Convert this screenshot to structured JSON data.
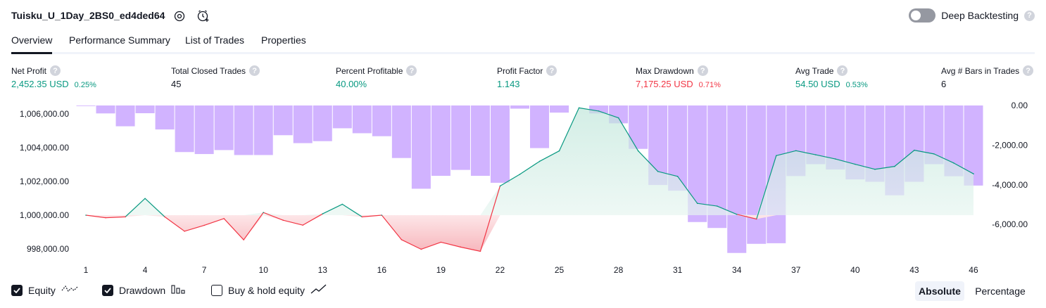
{
  "header": {
    "title": "Tuisku_U_1Day_2BS0_ed4ded64",
    "deep_backtesting_label": "Deep Backtesting",
    "help_glyph": "?"
  },
  "tabs": [
    {
      "label": "Overview",
      "active": true
    },
    {
      "label": "Performance Summary",
      "active": false
    },
    {
      "label": "List of Trades",
      "active": false
    },
    {
      "label": "Properties",
      "active": false
    }
  ],
  "metrics": [
    {
      "label": "Net Profit",
      "value": "2,452.35 USD",
      "pct": "0.25%",
      "color": "green"
    },
    {
      "label": "Total Closed Trades",
      "value": "45",
      "pct": "",
      "color": "dark"
    },
    {
      "label": "Percent Profitable",
      "value": "40.00%",
      "pct": "",
      "color": "green"
    },
    {
      "label": "Profit Factor",
      "value": "1.143",
      "pct": "",
      "color": "green"
    },
    {
      "label": "Max Drawdown",
      "value": "7,175.25 USD",
      "pct": "0.71%",
      "color": "red"
    },
    {
      "label": "Avg Trade",
      "value": "54.50 USD",
      "pct": "0.53%",
      "color": "green"
    },
    {
      "label": "Avg # Bars in Trades",
      "value": "6",
      "pct": "",
      "color": "dark"
    }
  ],
  "chart_data": {
    "type": "line",
    "x": [
      1,
      2,
      3,
      4,
      5,
      6,
      7,
      8,
      9,
      10,
      11,
      12,
      13,
      14,
      15,
      16,
      17,
      18,
      19,
      20,
      21,
      22,
      23,
      24,
      25,
      26,
      27,
      28,
      29,
      30,
      31,
      32,
      33,
      34,
      35,
      36,
      37,
      38,
      39,
      40,
      41,
      42,
      43,
      44,
      45,
      46
    ],
    "x_tick_labels": [
      "1",
      "4",
      "7",
      "10",
      "13",
      "16",
      "19",
      "22",
      "25",
      "28",
      "31",
      "34",
      "37",
      "40",
      "43",
      "46"
    ],
    "y_left_tick_labels": [
      "1,006,000.00",
      "1,004,000.00",
      "1,002,000.00",
      "1,000,000.00",
      "998,000.00"
    ],
    "y_left_ticks": [
      1006000,
      1004000,
      1002000,
      1000000,
      998000
    ],
    "y_left_range": [
      997000,
      1006500
    ],
    "y_right_tick_labels": [
      "0.00",
      "-2,000.00",
      "-4,000.00",
      "-6,000.00"
    ],
    "y_right_ticks": [
      0,
      -2000,
      -4000,
      -6000
    ],
    "y_right_range": [
      -7450,
      0
    ],
    "baseline": 1000000,
    "series": [
      {
        "name": "Equity",
        "kind": "line",
        "values": [
          1000000,
          999850,
          999900,
          1000990,
          999900,
          999050,
          999400,
          999800,
          998540,
          1000160,
          999700,
          999410,
          1000080,
          1000650,
          999900,
          1000000,
          998550,
          997980,
          998400,
          998110,
          997860,
          1001730,
          1002420,
          1003190,
          1003810,
          1006360,
          1006170,
          1005770,
          1003810,
          1002590,
          1002300,
          1000700,
          1000540,
          1000050,
          999770,
          1003530,
          1003820,
          1003580,
          1003330,
          1003020,
          1002720,
          1002890,
          1003850,
          1003630,
          1003090,
          1002450
        ]
      },
      {
        "name": "Drawdown",
        "kind": "bar",
        "values": [
          -30,
          -400,
          -1050,
          -390,
          -1210,
          -2350,
          -2450,
          -2250,
          -2500,
          -2500,
          -1500,
          -1900,
          -1800,
          -1150,
          -1400,
          -1550,
          -2650,
          -4200,
          -3550,
          -3250,
          -3550,
          -3900,
          -160,
          -2150,
          -360,
          0,
          -400,
          -900,
          -2190,
          -4010,
          -4300,
          -5880,
          -6180,
          -7440,
          -6980,
          -6950,
          -3560,
          -2960,
          -3230,
          -3730,
          -3850,
          -4530,
          -3850,
          -2960,
          -3570,
          -4040
        ]
      }
    ],
    "colors": {
      "equity_up": "#089981",
      "equity_down": "#f23645",
      "drawdown_bar": "#d1b3ff",
      "equity_fill_up": "#e2f3ee",
      "equity_fill_down": "#fde1e3"
    },
    "grid": false
  },
  "legend": [
    {
      "label": "Equity",
      "checked": true,
      "icon": "equity-icon"
    },
    {
      "label": "Drawdown",
      "checked": true,
      "icon": "drawdown-icon"
    },
    {
      "label": "Buy & hold equity",
      "checked": false,
      "icon": "buy-hold-icon"
    }
  ],
  "view_toggle": {
    "absolute": "Absolute",
    "percentage": "Percentage",
    "selected": "absolute"
  }
}
